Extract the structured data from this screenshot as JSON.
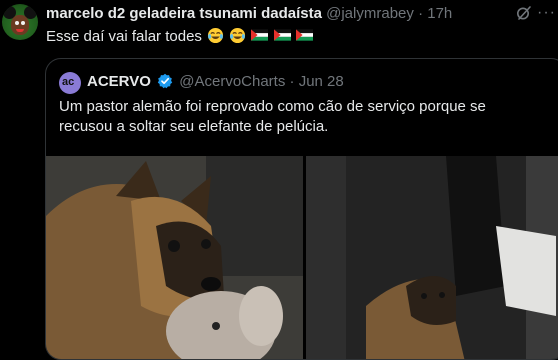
{
  "tweet": {
    "author_name": "marcelo d2 geladeira tsunami dadaísta",
    "author_handle": "@jalymrabey",
    "separator": "·",
    "time": "17h",
    "text": "Esse daí vai falar todes",
    "emojis": [
      "face-with-tears-of-joy",
      "face-with-tears-of-joy",
      "palestine-flag",
      "palestine-flag",
      "palestine-flag"
    ]
  },
  "quote": {
    "author_name": "ACERVO",
    "author_handle": "@AcervoCharts",
    "separator": "·",
    "date": "Jun 28",
    "text": "Um pastor alemão foi reprovado como cão de serviço porque se recusou a soltar seu elefante de pelúcia.",
    "avatar_glyph": "ac"
  },
  "colors": {
    "background": "#000000",
    "text": "#e7e9ea",
    "muted": "#71767b",
    "border": "#2f3336",
    "verified": "#1d9bf0"
  }
}
